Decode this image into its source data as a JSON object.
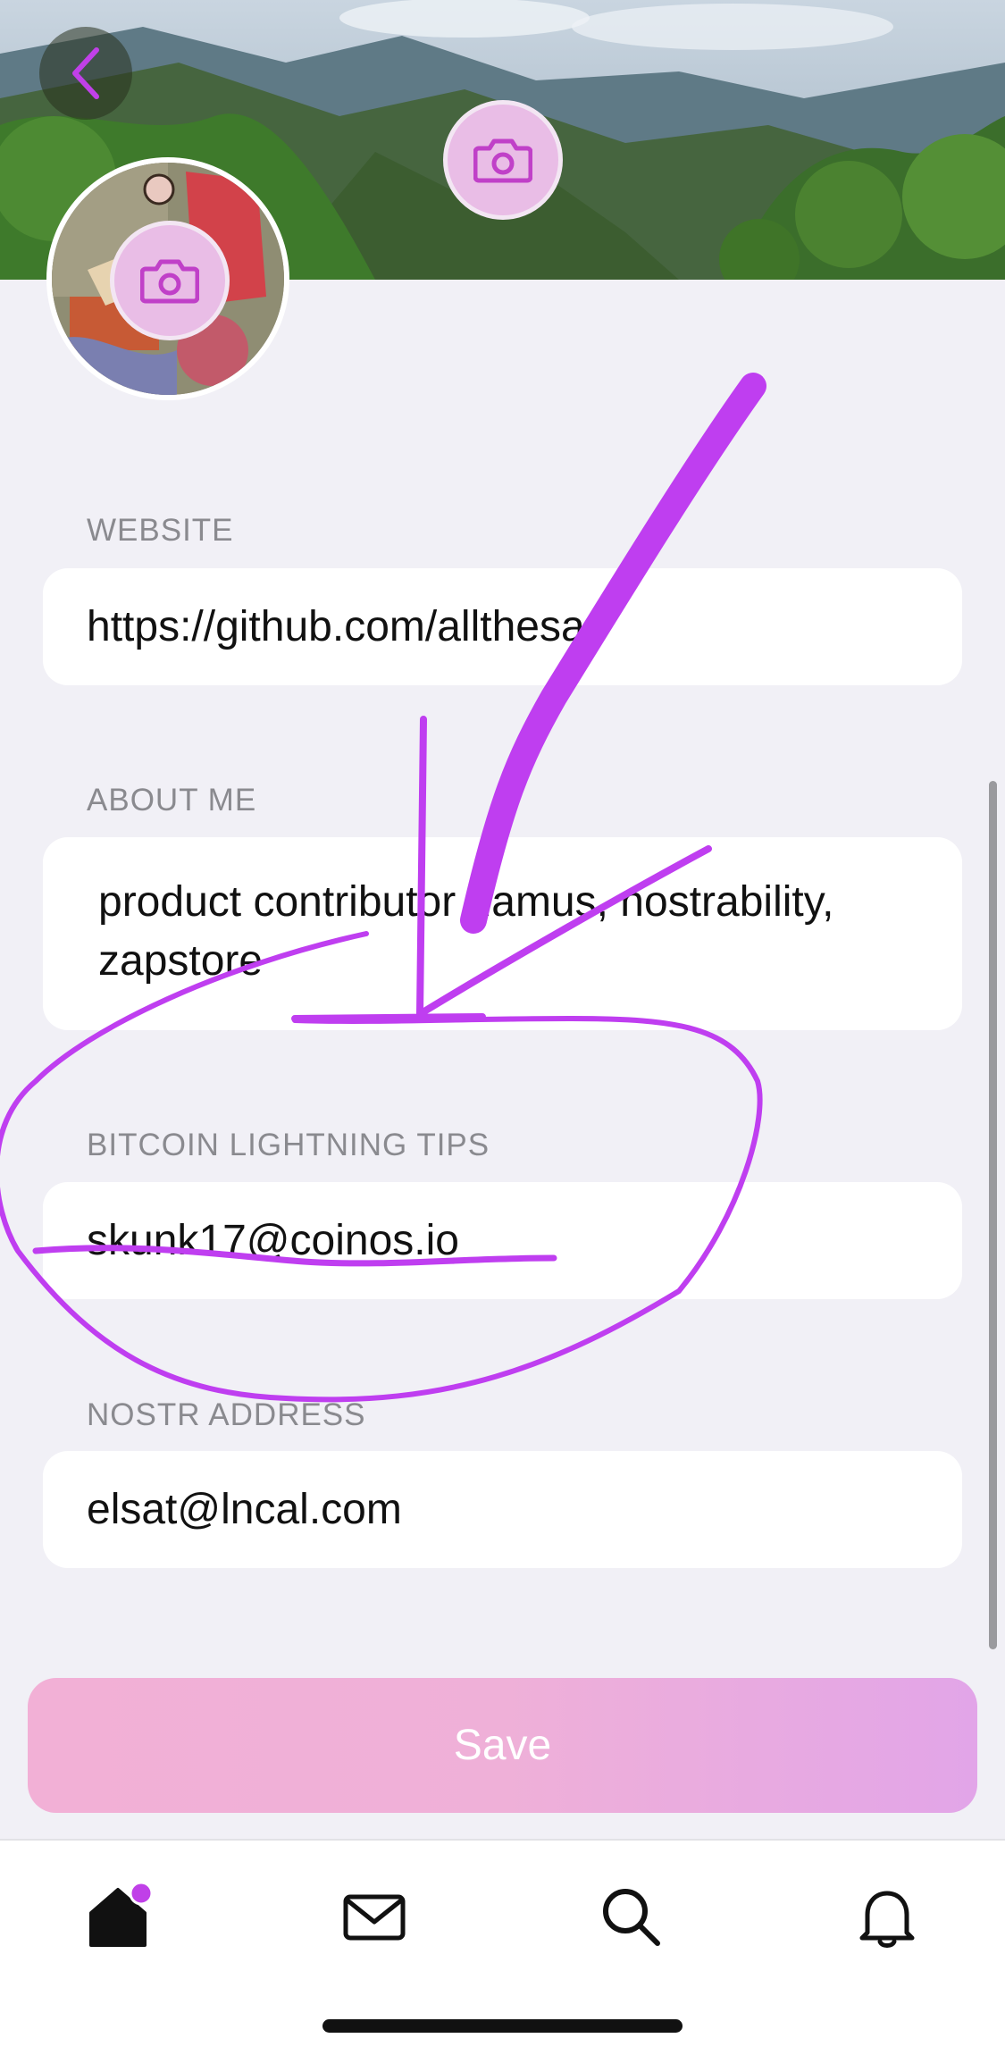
{
  "header": {
    "back_icon": "chevron-left-icon",
    "banner_camera_icon": "camera-icon",
    "avatar_camera_icon": "camera-icon"
  },
  "form": {
    "website": {
      "label": "WEBSITE",
      "value": "https://github.com/allthesas"
    },
    "about": {
      "label": "ABOUT ME",
      "value": "product contributor damus, nostrability, zapstore"
    },
    "lightning": {
      "label": "BITCOIN LIGHTNING TIPS",
      "value": "skunk17@coinos.io"
    },
    "nostr": {
      "label": "NOSTR ADDRESS",
      "value": "elsat@lncal.com"
    }
  },
  "actions": {
    "save_label": "Save"
  },
  "tabbar": {
    "items": [
      "home-icon",
      "mail-icon",
      "search-icon",
      "bell-icon"
    ],
    "home_badge": true
  },
  "colors": {
    "accent": "#c040e8",
    "accent_light": "#e9bde6",
    "save_gradient_start": "#f2b0d6",
    "save_gradient_end": "#e2a5e8",
    "annotation": "#bf3ef0",
    "background": "#f1f0f6"
  }
}
